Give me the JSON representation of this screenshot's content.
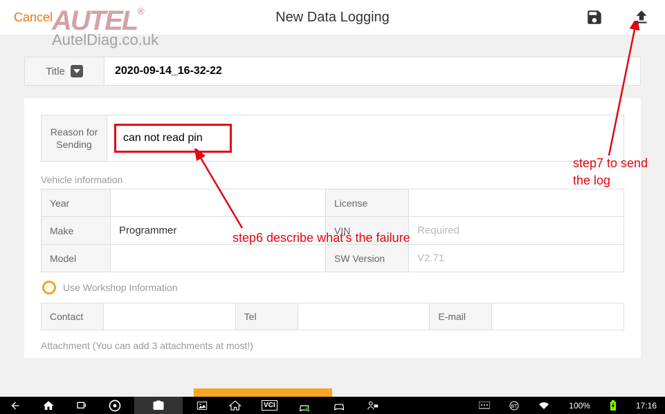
{
  "header": {
    "cancel": "Cancel",
    "title": "New Data Logging"
  },
  "watermark": {
    "brand": "AUTEL",
    "reg": "®",
    "site": "AutelDiag.co.uk"
  },
  "titleRow": {
    "label": "Title",
    "value": "2020-09-14_16-32-22"
  },
  "reason": {
    "label": "Reason for Sending",
    "value": "can not read pin"
  },
  "vehicle": {
    "section": "Vehicle information",
    "yearLabel": "Year",
    "yearValue": "",
    "licenseLabel": "License",
    "licenseValue": "",
    "makeLabel": "Make",
    "makeValue": "Programmer",
    "vinLabel": "VIN",
    "vinValue": "Required",
    "modelLabel": "Model",
    "modelValue": "",
    "swLabel": "SW Version",
    "swValue": "V2.71"
  },
  "workshop": {
    "label": "Use Workshop Information"
  },
  "contact": {
    "contactLabel": "Contact",
    "telLabel": "Tel",
    "emailLabel": "E-mail"
  },
  "attach": {
    "label": "Attachment  (You can add 3 attachments at most!)"
  },
  "statusbar": {
    "battery": "100%",
    "time": "17:16"
  },
  "annotations": {
    "step6": "step6 describe what's the failure",
    "step7": "step7 to send the log"
  }
}
